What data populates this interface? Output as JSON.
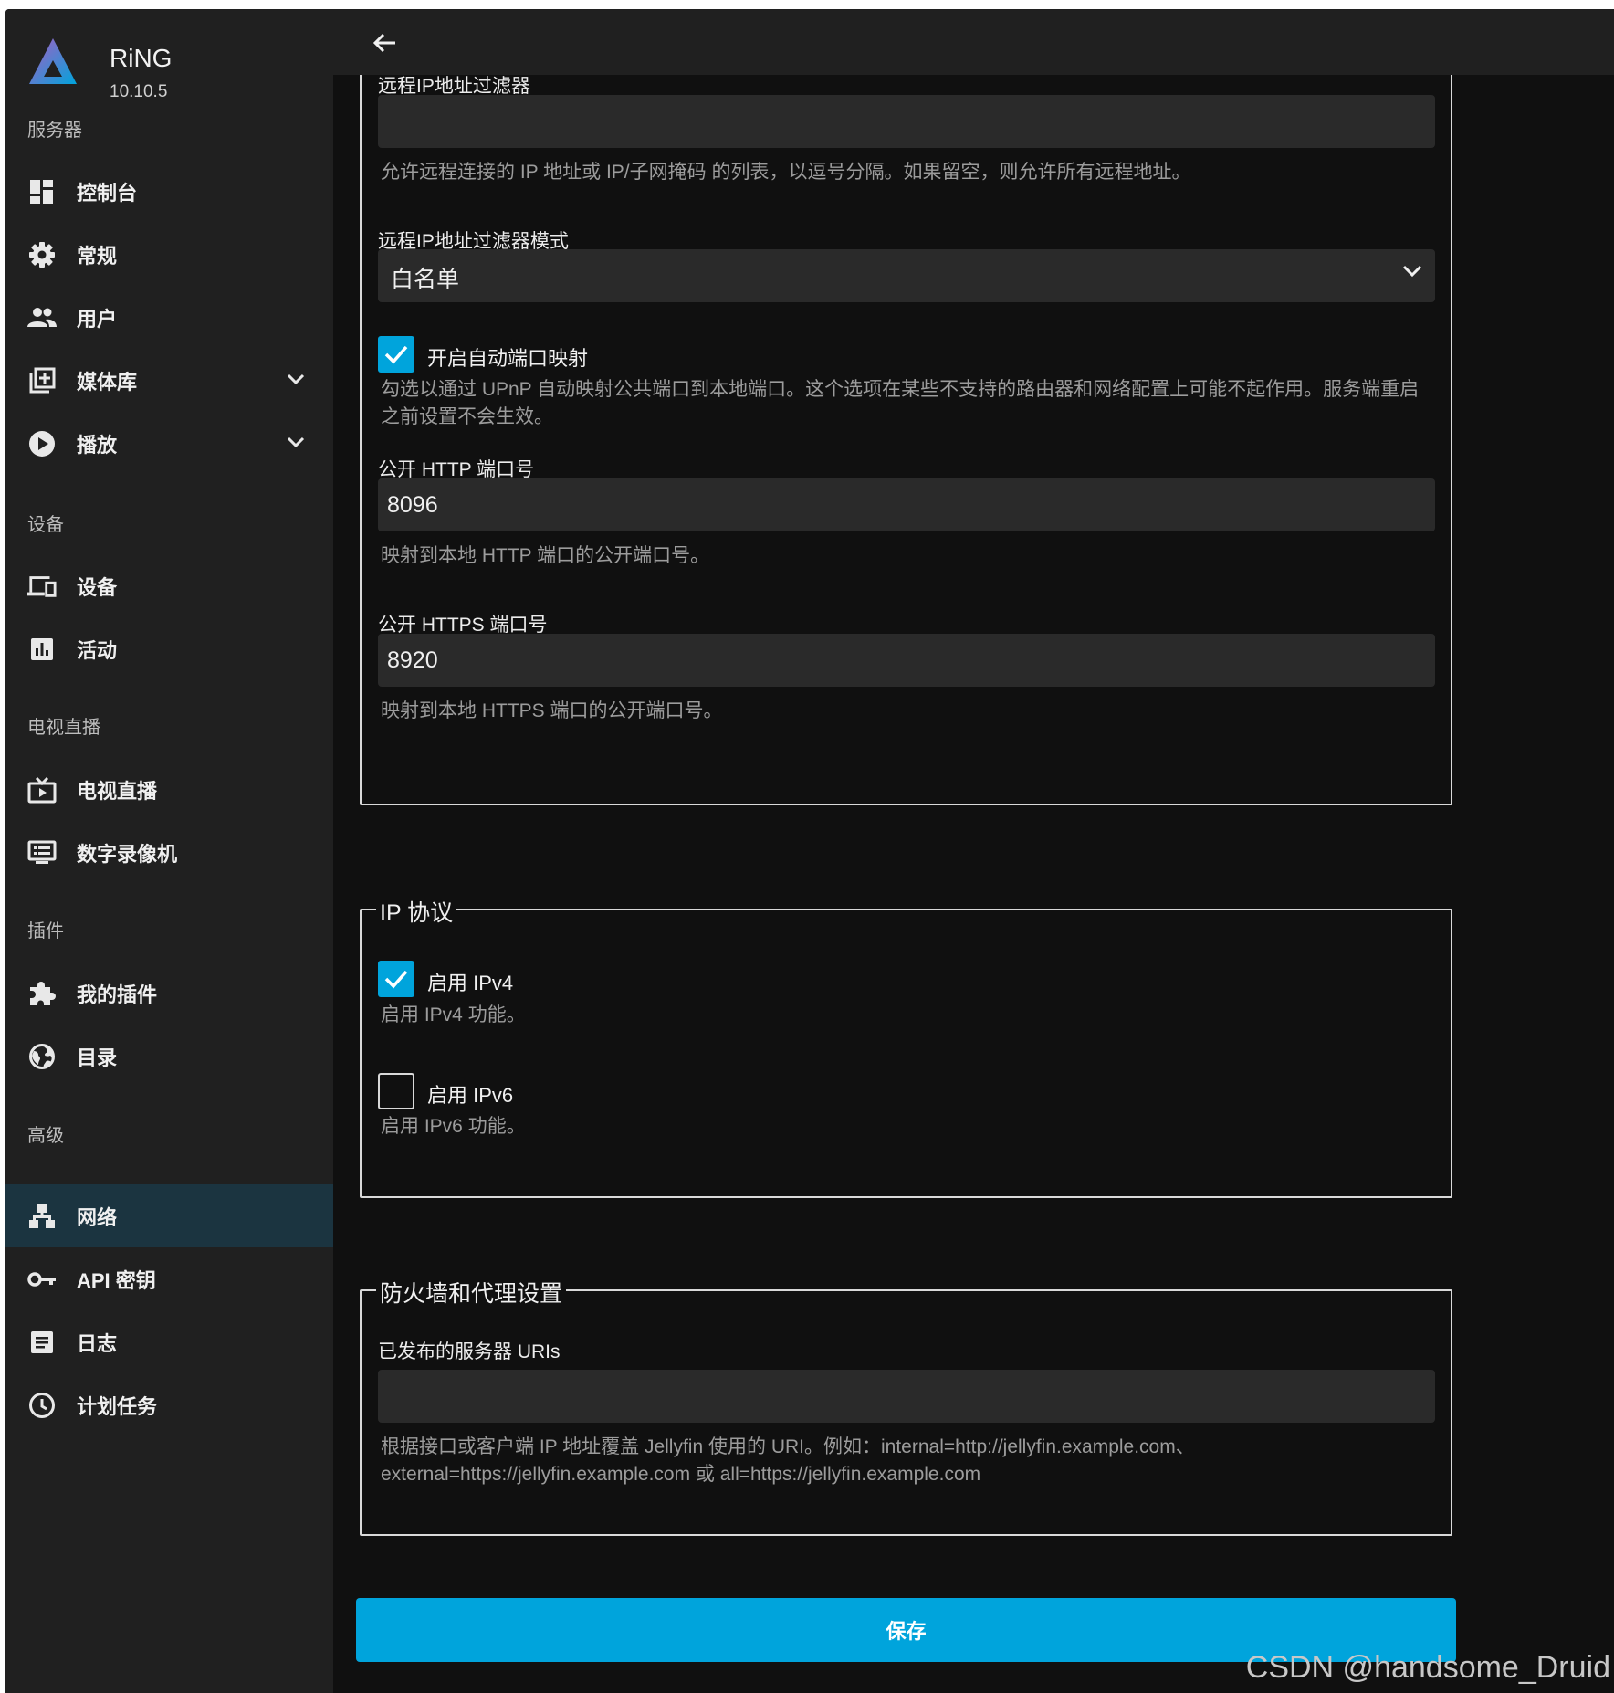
{
  "app": {
    "name": "RiNG",
    "version": "10.10.5"
  },
  "sidebar": {
    "sections": {
      "server": "服务器",
      "devices": "设备",
      "livetv": "电视直播",
      "plugins": "插件",
      "advanced": "高级"
    },
    "items": {
      "dashboard": "控制台",
      "general": "常规",
      "users": "用户",
      "libraries": "媒体库",
      "playback": "播放",
      "devices": "设备",
      "activity": "活动",
      "livetv": "电视直播",
      "dvr": "数字录像机",
      "my_plugins": "我的插件",
      "catalog": "目录",
      "networking": "网络",
      "api_keys": "API 密钥",
      "logs": "日志",
      "scheduled_tasks": "计划任务"
    }
  },
  "remote_access": {
    "ip_filter_label": "远程IP地址过滤器",
    "ip_filter_value": "",
    "ip_filter_help": "允许远程连接的 IP 地址或 IP/子网掩码 的列表，以逗号分隔。如果留空，则允许所有远程地址。",
    "filter_mode_label": "远程IP地址过滤器模式",
    "filter_mode_value": "白名单",
    "upnp_label": "开启自动端口映射",
    "upnp_checked": true,
    "upnp_help": "勾选以通过 UPnP 自动映射公共端口到本地端口。这个选项在某些不支持的路由器和网络配置上可能不起作用。服务端重启之前设置不会生效。",
    "http_port_label": "公开 HTTP 端口号",
    "http_port_value": "8096",
    "http_port_help": "映射到本地 HTTP 端口的公开端口号。",
    "https_port_label": "公开 HTTPS 端口号",
    "https_port_value": "8920",
    "https_port_help": "映射到本地 HTTPS 端口的公开端口号。"
  },
  "ip_protocols": {
    "legend": "IP 协议",
    "ipv4_label": "启用 IPv4",
    "ipv4_checked": true,
    "ipv4_help": "启用 IPv4 功能。",
    "ipv6_label": "启用 IPv6",
    "ipv6_checked": false,
    "ipv6_help": "启用 IPv6 功能。"
  },
  "firewall": {
    "legend": "防火墙和代理设置",
    "uris_label": "已发布的服务器 URIs",
    "uris_value": "",
    "uris_help_line1": "根据接口或客户端 IP 地址覆盖 Jellyfin 使用的 URI。例如：internal=http://jellyfin.example.com、",
    "uris_help_line2": "external=https://jellyfin.example.com 或 all=https://jellyfin.example.com"
  },
  "save_label": "保存",
  "watermark": "CSDN @handsome_Druid",
  "colors": {
    "accent": "#00a4dc",
    "active_nav": "#1b3440",
    "background": "#101010",
    "sidebar": "#202020"
  }
}
